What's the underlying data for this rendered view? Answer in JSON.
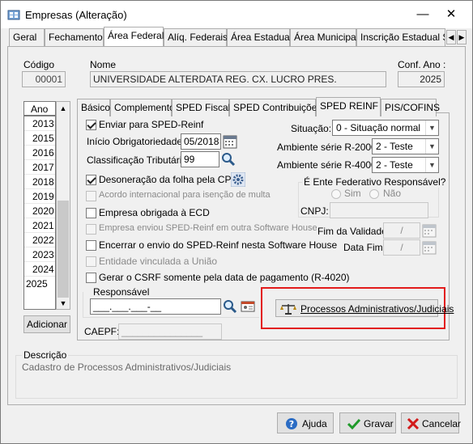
{
  "window": {
    "title": "Empresas (Alteração)"
  },
  "tabs": [
    "Geral",
    "Fechamento",
    "Área Federal",
    "Alíq. Federais",
    "Área Estadual",
    "Área Municipal",
    "Inscrição Estadual S"
  ],
  "header": {
    "codigo_label": "Código",
    "codigo_value": "00001",
    "nome_label": "Nome",
    "nome_value": "UNIVERSIDADE ALTERDATA REG. CX. LUCRO PRES.",
    "conf_ano_label": "Conf. Ano :",
    "conf_ano_value": "2025"
  },
  "years": {
    "header": "Ano",
    "items": [
      "2013",
      "2015",
      "2016",
      "2017",
      "2018",
      "2019",
      "2020",
      "2021",
      "2022",
      "2023",
      "2024",
      "2025"
    ],
    "selected": "2025",
    "add_button": "Adicionar"
  },
  "subtabs": [
    "Básico",
    "Complemento",
    "SPED Fiscal",
    "SPED Contribuições",
    "SPED REINF",
    "PIS/COFINS"
  ],
  "reinf": {
    "enviar": "Enviar para SPED-Reinf",
    "inicio_label": "Início Obrigatoriedade:",
    "inicio_value": "05/2018",
    "classif_label": "Classificação Tributária:",
    "classif_value": "99",
    "desoneracao": "Desoneração da folha pela CPRB",
    "acordo": "Acordo internacional para isenção de multa",
    "obrigada_ecd": "Empresa obrigada à ECD",
    "enviou_outro": "Empresa enviou SPED-Reinf em outra Software House",
    "encerrar": "Encerrar o envio do SPED-Reinf nesta Software House",
    "vinculada": "Entidade vinculada a União",
    "gerar_csrf": "Gerar o CSRF somente pela data de pagamento (R-4020)",
    "situacao_label": "Situação:",
    "situacao_value": "0 - Situação normal",
    "amb2000_label": "Ambiente série R-2000:",
    "amb2000_value": "2 - Teste",
    "amb4000_label": "Ambiente série R-4000:",
    "amb4000_value": "2 - Teste",
    "ente_label": "É Ente Federativo Responsável?",
    "sim": "Sim",
    "nao": "Não",
    "cnpj_label": "CNPJ:",
    "fim_validade_label": "Fim da Validade:",
    "fim_validade_value": "/",
    "data_fim_label": "Data Fim:",
    "data_fim_value": "/",
    "responsavel_label": "Responsável",
    "responsavel_value": "___.___.___-__",
    "processos_button": "Processos Administrativos/Judiciais",
    "caepf_label": "CAEPF:",
    "caepf_value": "_______________"
  },
  "descricao": {
    "label": "Descrição",
    "text": "Cadastro de Processos Administrativos/Judiciais"
  },
  "footer": {
    "ajuda": "Ajuda",
    "gravar": "Gravar",
    "cancelar": "Cancelar"
  },
  "colors": {
    "highlight": "#e21b1b",
    "accent": "#2b7bd6"
  }
}
